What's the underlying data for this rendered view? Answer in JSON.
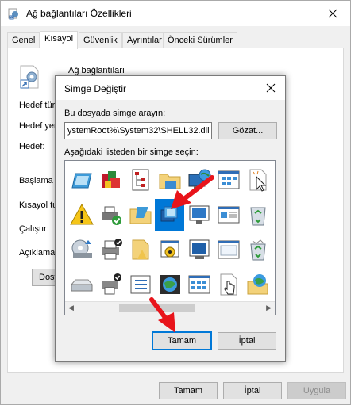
{
  "outer_window": {
    "title": "Ağ bağlantıları Özellikleri",
    "tabs": [
      {
        "label": "Genel",
        "active": false
      },
      {
        "label": "Kısayol",
        "active": true
      },
      {
        "label": "Güvenlik",
        "active": false
      },
      {
        "label": "Ayrıntılar",
        "active": false
      },
      {
        "label": "Önceki Sürümler",
        "active": false
      }
    ],
    "shortcut_name": "Ağ bağlantıları",
    "fields": [
      {
        "label": "Hedef tür"
      },
      {
        "label": "Hedef yer"
      },
      {
        "label": "Hedef:"
      },
      {
        "label": "Başlama y"
      },
      {
        "label": "Kısayol tu"
      },
      {
        "label": "Çalıştır:"
      },
      {
        "label": "Açıklama:"
      }
    ],
    "panel_button": "Dosy",
    "buttons": {
      "ok": "Tamam",
      "cancel": "İptal",
      "apply": "Uygula"
    }
  },
  "dialog": {
    "title": "Simge Değiştir",
    "search_label": "Bu dosyada simge arayın:",
    "path_value": "ystemRoot%\\System32\\SHELL32.dll",
    "browse_button": "Gözat...",
    "list_label": "Aşağıdaki listeden bir simge seçin:",
    "ok_button": "Tamam",
    "cancel_button": "İptal",
    "selected_icon": "network-connections-icon"
  },
  "colors": {
    "accent": "#0078d7",
    "annotation_arrow": "#e8141b"
  }
}
